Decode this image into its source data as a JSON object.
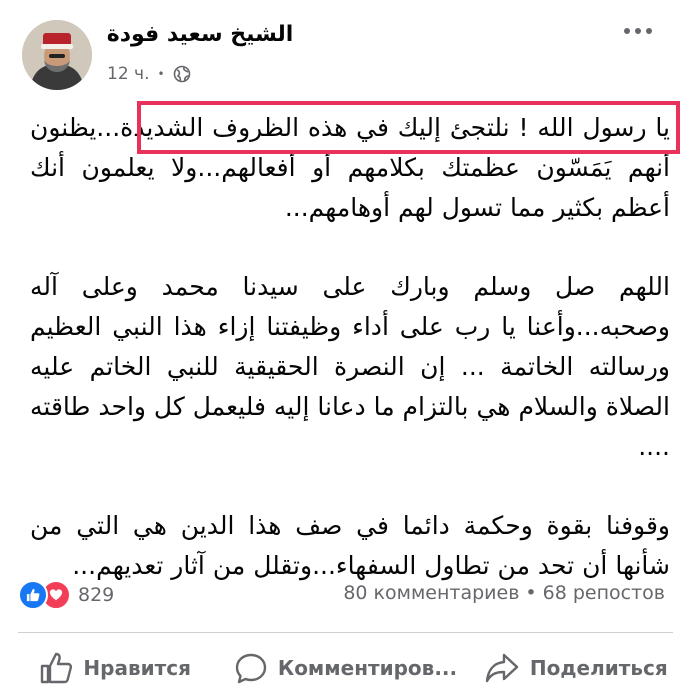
{
  "post": {
    "author": "الشيخ سعيد فودة",
    "time": "12 ч.",
    "separator": "•",
    "privacy_icon": "globe-icon",
    "highlighted_sentence": "يا رسول الله ! نلتجئ إليك في هذه الظروف الشديدة...",
    "paragraph1_rest": "يظنون أنهم يَمَسّون عظمتك بكلامهم أو أفعالهم...ولا يعلمون أنك أعظم بكثير مما تسول لهم أوهامهم...",
    "paragraph2": "اللهم صل وسلم وبارك على سيدنا محمد وعلى آله وصحبه...وأعنا يا رب على أداء وظيفتنا إزاء هذا النبي العظيم ورسالته الخاتمة ... إن النصرة الحقيقية للنبي الخاتم عليه الصلاة والسلام هي بالتزام ما دعانا إليه فليعمل كل واحد طاقته ....",
    "paragraph3": "وقوفنا بقوة وحكمة دائما في صف هذا الدين هي التي من شأنها أن تحد من تطاول السفهاء...وتقلل من آثار تعديهم..."
  },
  "stats": {
    "reaction_count": "829",
    "comments": "80 комментариев",
    "dot": "•",
    "shares": "68 репостов"
  },
  "actions": {
    "like": "Нравится",
    "comment": "Комментиров...",
    "share": "Поделиться"
  },
  "colors": {
    "highlight_border": "#e8315b",
    "like_blue": "#1877f2",
    "love_red": "#f33e58",
    "secondary_text": "#65676b"
  }
}
